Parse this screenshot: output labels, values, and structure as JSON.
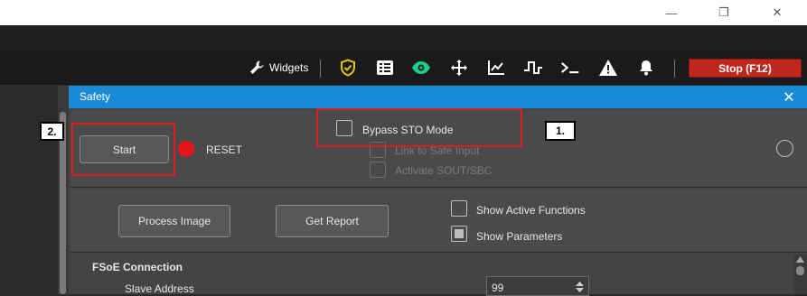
{
  "window_controls": {
    "minimize": "—",
    "maximize": "❐",
    "close": "✕"
  },
  "toolbar": {
    "widgets_label": "Widgets",
    "stop_label": "Stop (F12)",
    "colors": {
      "stop_bg": "#c0271c",
      "shield": "#e8c200",
      "eye": "#1bd18a"
    }
  },
  "dialog": {
    "title": "Safety",
    "close_glyph": "✕",
    "start_label": "Start",
    "reset_label": "RESET",
    "bypass_label": "Bypass STO Mode",
    "link_safe_input_label": "Link to Safe Input",
    "activate_sout_label": "Activate SOUT/SBC",
    "process_image_label": "Process Image",
    "get_report_label": "Get Report",
    "show_active_functions_label": "Show Active Functions",
    "show_parameters_label": "Show Parameters",
    "show_parameters_checked": true,
    "fsoe_header": "FSoE Connection",
    "slave_address_label": "Slave Address",
    "slave_address_value": "99",
    "reset_indicator_color": "#e8141b"
  },
  "callouts": {
    "one": "1.",
    "two": "2."
  }
}
